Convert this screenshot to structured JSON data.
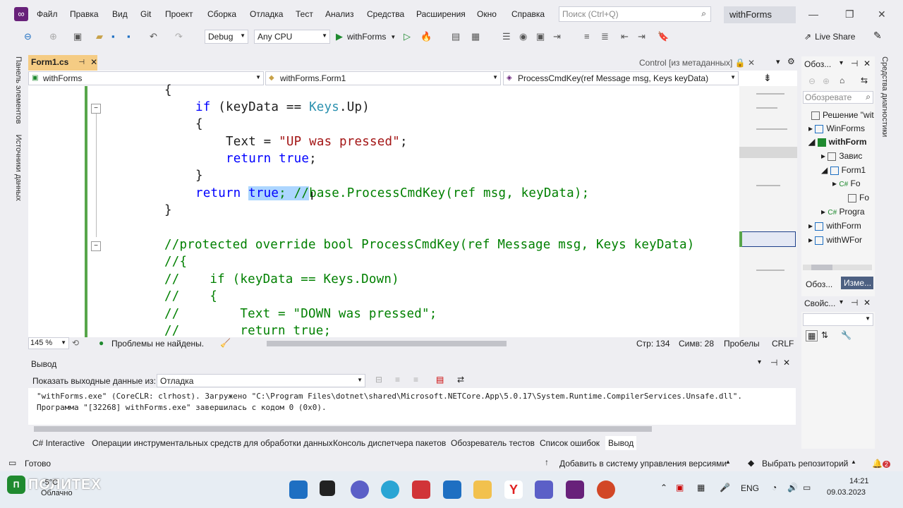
{
  "menu": [
    "Файл",
    "Правка",
    "Вид",
    "Git",
    "Проект",
    "Сборка",
    "Отладка",
    "Тест",
    "Анализ",
    "Средства",
    "Расширения",
    "Окно",
    "Справка"
  ],
  "search": {
    "placeholder": "Поиск (Ctrl+Q)"
  },
  "window": {
    "title": "withForms"
  },
  "toolbar": {
    "config": "Debug",
    "platform": "Any CPU",
    "run_label": "withForms",
    "live_share": "Live Share"
  },
  "left_strip": {
    "toolbox": "Панель элементов",
    "datasources": "Источники данных"
  },
  "doc_tab": {
    "label": "Form1.cs"
  },
  "control_label": "Control [из метаданных]",
  "nav": {
    "project": "withForms",
    "class": "withForms.Form1",
    "member": "ProcessCmdKey(ref Message msg, Keys keyData)"
  },
  "code": {
    "l1": "{",
    "l2_kw": "if",
    "l2_a": " (keyData == ",
    "l2_ty": "Keys",
    "l2_b": ".Up)",
    "l3": "{",
    "l4_a": "Text = ",
    "l4_s": "\"UP was pressed\"",
    "l4_b": ";",
    "l5_kw": "return",
    "l5_kw2": "true",
    "l5_b": ";",
    "l6": "}",
    "l7_kw": "return",
    "l7_sel1": "true",
    "l7_sel2": "; //",
    "l7_cm": "base.ProcessCmdKey(ref msg, keyData);",
    "l8": "}",
    "c1": "//protected override bool ProcessCmdKey(ref Message msg, Keys keyData)",
    "c2": "//{",
    "c3": "//    if (keyData == Keys.Down)",
    "c4": "//    {",
    "c5": "//        Text = \"DOWN was pressed\";",
    "c6": "//        return true;"
  },
  "editor_status": {
    "zoom": "145 %",
    "issues": "Проблемы не найдены.",
    "line": "Стр: 134",
    "col": "Симв: 28",
    "spaces": "Пробелы",
    "eol": "CRLF"
  },
  "output": {
    "title": "Вывод",
    "show_label": "Показать выходные данные из:",
    "source": "Отладка",
    "lines": [
      "\"withForms.exe\" (CoreCLR: clrhost). Загружено \"C:\\Program Files\\dotnet\\shared\\Microsoft.NETCore.App\\5.0.17\\System.Runtime.CompilerServices.Unsafe.dll\".",
      "Программа \"[32268] withForms.exe\" завершилась с кодом 0 (0x0)."
    ]
  },
  "bottom_tabs": [
    "C# Interactive",
    "Операции инструментальных средств для обработки данных",
    "Консоль диспетчера пакетов",
    "Обозреватель тестов",
    "Список ошибок",
    "Вывод"
  ],
  "status": {
    "ready": "Готово",
    "vcs": "Добавить в систему управления версиями",
    "repo": "Выбрать репозиторий",
    "notif": "2"
  },
  "solution": {
    "title": "Обоз...",
    "search_placeholder": "Обозревате",
    "items": [
      "Решение \"wit",
      "WinForms",
      "withForm",
      "Завис",
      "Form1",
      "Fo",
      "Fo",
      "Progra",
      "withForm",
      "withWFor"
    ],
    "tab1": "Обоз...",
    "tab2": "Изме...",
    "right_strip": "Средства диагностики"
  },
  "props": {
    "title": "Свойс..."
  },
  "taskbar": {
    "weather_temp": "-5°C",
    "weather_text": "Облачно",
    "lang": "ENG",
    "time": "14:21",
    "date": "09.03.2023",
    "watermark": "ПОЛИТЕХ"
  }
}
